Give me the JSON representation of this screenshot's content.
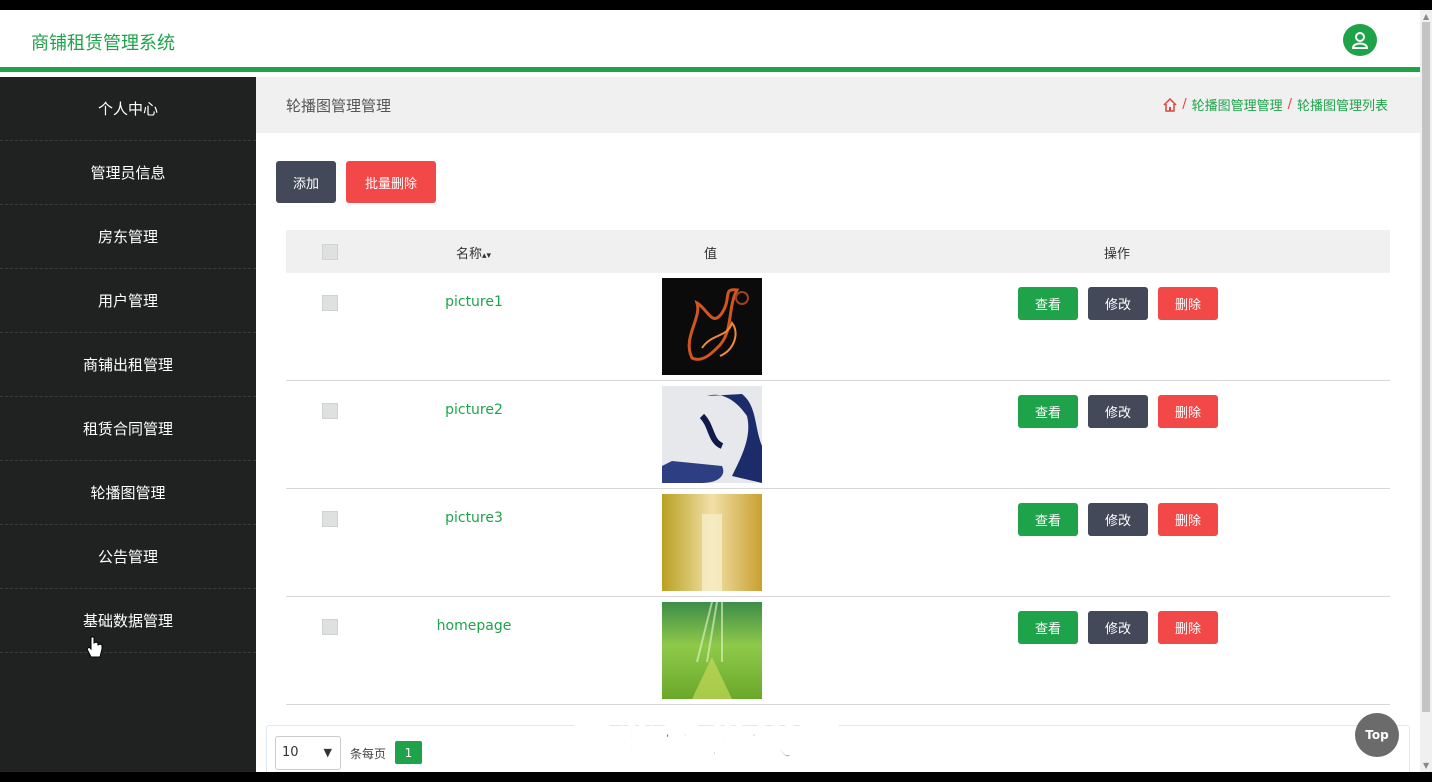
{
  "app": {
    "title": "商铺租赁管理系统"
  },
  "sidebar": {
    "items": [
      {
        "label": "个人中心"
      },
      {
        "label": "管理员信息"
      },
      {
        "label": "房东管理"
      },
      {
        "label": "用户管理"
      },
      {
        "label": "商铺出租管理"
      },
      {
        "label": "租赁合同管理"
      },
      {
        "label": "轮播图管理"
      },
      {
        "label": "公告管理"
      },
      {
        "label": "基础数据管理"
      }
    ]
  },
  "page": {
    "title": "轮播图管理管理",
    "breadcrumb": [
      "轮播图管理管理",
      "轮播图管理列表"
    ]
  },
  "toolbar": {
    "add_label": "添加",
    "batch_delete_label": "批量删除"
  },
  "table": {
    "headers": {
      "name": "名称",
      "value": "值",
      "actions": "操作"
    },
    "rows": [
      {
        "name": "picture1",
        "view": "查看",
        "edit": "修改",
        "del": "删除"
      },
      {
        "name": "picture2",
        "view": "查看",
        "edit": "修改",
        "del": "删除"
      },
      {
        "name": "picture3",
        "view": "查看",
        "edit": "修改",
        "del": "删除"
      },
      {
        "name": "homepage",
        "view": "查看",
        "edit": "修改",
        "del": "删除"
      }
    ]
  },
  "pagination": {
    "page_size": "10",
    "per_page_label": "条每页",
    "current_page": "1"
  },
  "overlay": {
    "watermark": "专业毕设代做",
    "top_button": "Top"
  },
  "colors": {
    "accent": "#1fa34a",
    "danger": "#f24848",
    "dark_button": "#44495a",
    "sidebar_bg": "#202221"
  },
  "icons": {
    "user": "user-avatar-icon",
    "home": "home-icon",
    "sort": "sort-icon"
  }
}
